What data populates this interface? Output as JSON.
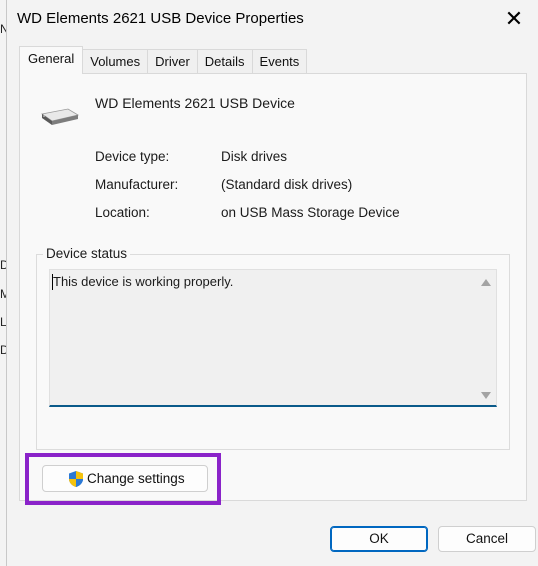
{
  "background_letters": [
    "N",
    "D",
    "M",
    "L",
    "D"
  ],
  "dialog": {
    "title": "WD Elements 2621 USB Device Properties",
    "close_label": "✕",
    "tabs": [
      {
        "label": "General",
        "active": true
      },
      {
        "label": "Volumes",
        "active": false
      },
      {
        "label": "Driver",
        "active": false
      },
      {
        "label": "Details",
        "active": false
      },
      {
        "label": "Events",
        "active": false
      }
    ],
    "device_name": "WD Elements 2621 USB Device",
    "device_icon": "drive-icon",
    "properties": [
      {
        "label": "Device type:",
        "value": "Disk drives"
      },
      {
        "label": "Manufacturer:",
        "value": "(Standard disk drives)"
      },
      {
        "label": "Location:",
        "value": "on USB Mass Storage Device"
      }
    ],
    "status_group_label": "Device status",
    "status_text": "This device is working properly.",
    "change_settings": {
      "label": "Change settings",
      "icon": "shield-icon"
    },
    "ok_label": "OK",
    "cancel_label": "Cancel"
  },
  "colors": {
    "highlight": "#8a23c9",
    "accent": "#0067c0"
  }
}
